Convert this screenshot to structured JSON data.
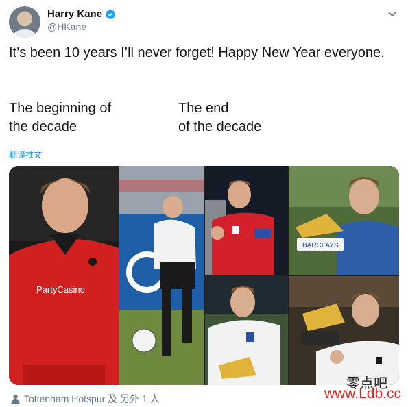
{
  "user": {
    "display_name": "Harry Kane",
    "handle": "@HKane",
    "verified": true
  },
  "tweet": {
    "text": "It’s been 10 years I’ll never forget! Happy New Year everyone.",
    "left_column": "The beginning of\nthe decade",
    "right_column": "The end\n of the decade",
    "translate_label": "翻译推文"
  },
  "media": {
    "left_photo_shirt_text": "PartyCasino",
    "right_top_sign_text": "BARCLAYS"
  },
  "footer": {
    "tagged_text": "Tottenham Hotspur 及 另外 1 人"
  },
  "watermark": {
    "chinese": "零点吧",
    "url": "www.Ldb.cc"
  },
  "colors": {
    "verified_blue": "#1da1f2",
    "link_blue": "#1b95e0",
    "secondary_text": "#657786",
    "watermark_red": "#e0241b"
  },
  "icons": {
    "verified": "verified-badge-icon",
    "menu": "chevron-down-icon",
    "tagged": "person-icon"
  }
}
